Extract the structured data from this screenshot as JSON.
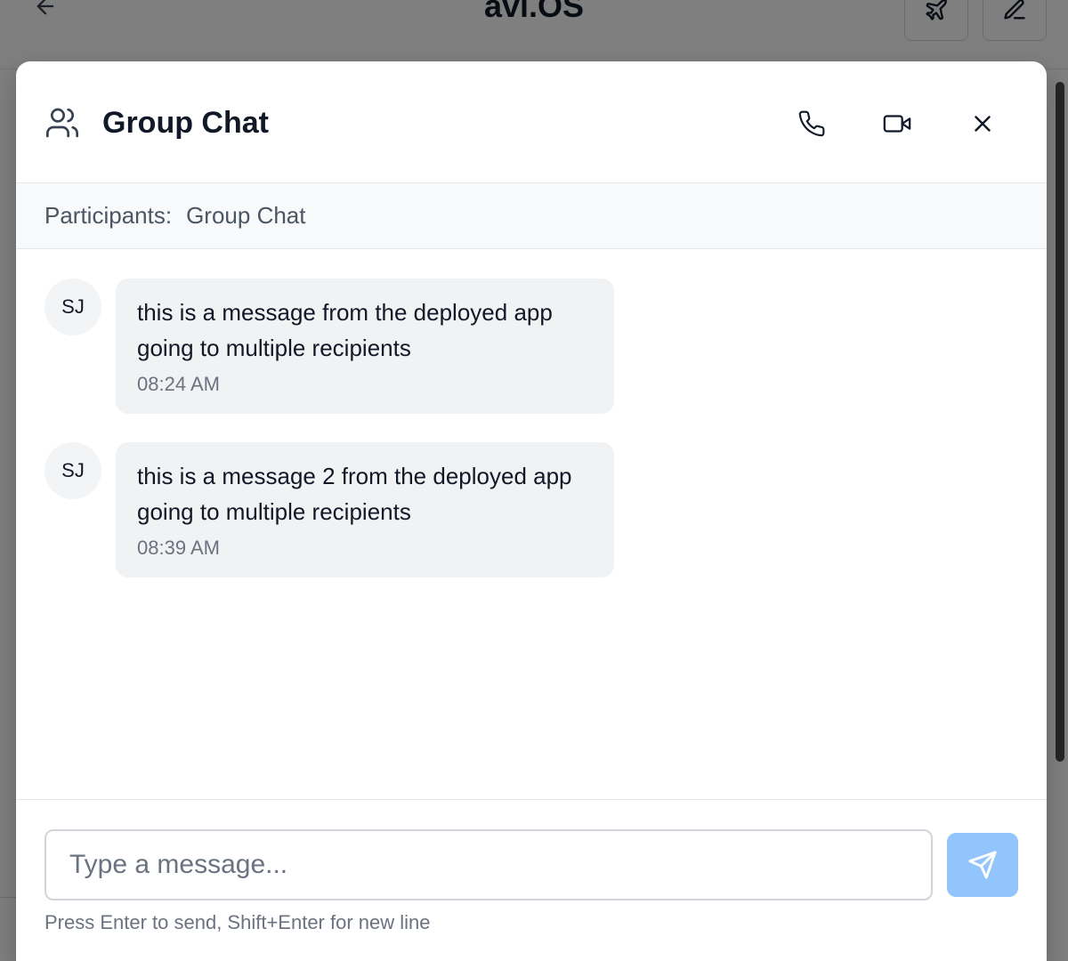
{
  "background_app": {
    "title": "avi.OS",
    "icons": {
      "back": "arrow-left-icon",
      "plane": "plane-icon",
      "edit": "pencil-icon"
    }
  },
  "modal": {
    "title": "Group Chat",
    "icons": {
      "group": "users-icon",
      "phone": "phone-icon",
      "video": "video-icon",
      "close": "close-icon"
    },
    "participants_label": "Participants:",
    "participants_value": "Group Chat"
  },
  "messages": [
    {
      "avatar": "SJ",
      "text": "this is a message from the deployed app going to multiple recipients",
      "time": "08:24 AM"
    },
    {
      "avatar": "SJ",
      "text": "this is a message 2 from the deployed app going to multiple recipients",
      "time": "08:39 AM"
    }
  ],
  "composer": {
    "placeholder": "Type a message...",
    "hint": "Press Enter to send, Shift+Enter for new line",
    "send_icon": "send-icon"
  },
  "colors": {
    "send_button": "#93c5fd",
    "bubble": "#f1f2f4",
    "participants_bar": "#f8f9fb"
  }
}
